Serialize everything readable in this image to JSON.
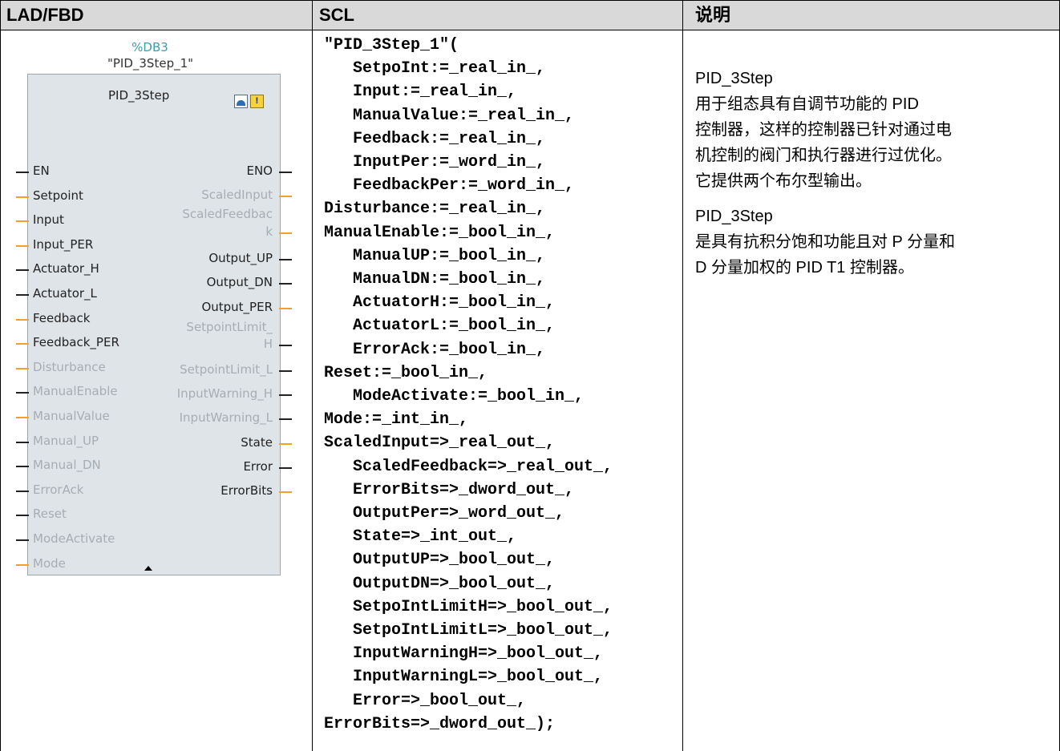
{
  "headers": {
    "col1": "LAD/FBD",
    "col2": "SCL",
    "col3": "说明"
  },
  "lad": {
    "db": "%DB3",
    "instance": "\"PID_3Step_1\"",
    "block_title": "PID_3Step",
    "inputs": [
      {
        "label": "EN",
        "state": "dark",
        "lead": "black"
      },
      {
        "label": "Setpoint",
        "state": "dark",
        "lead": "orange"
      },
      {
        "label": "Input",
        "state": "dark",
        "lead": "orange"
      },
      {
        "label": "Input_PER",
        "state": "dark",
        "lead": "orange"
      },
      {
        "label": "Actuator_H",
        "state": "dark",
        "lead": "black"
      },
      {
        "label": "Actuator_L",
        "state": "dark",
        "lead": "black"
      },
      {
        "label": "Feedback",
        "state": "dark",
        "lead": "orange"
      },
      {
        "label": "Feedback_PER",
        "state": "dark",
        "lead": "orange"
      },
      {
        "label": "Disturbance",
        "state": "gray",
        "lead": "orange"
      },
      {
        "label": "ManualEnable",
        "state": "gray",
        "lead": "black"
      },
      {
        "label": "ManualValue",
        "state": "gray",
        "lead": "orange"
      },
      {
        "label": "Manual_UP",
        "state": "gray",
        "lead": "black"
      },
      {
        "label": "Manual_DN",
        "state": "gray",
        "lead": "black"
      },
      {
        "label": "ErrorAck",
        "state": "gray",
        "lead": "black"
      },
      {
        "label": "Reset",
        "state": "gray",
        "lead": "black"
      },
      {
        "label": "ModeActivate",
        "state": "gray",
        "lead": "black"
      },
      {
        "label": "Mode",
        "state": "gray",
        "lead": "orange"
      }
    ],
    "outputs": [
      {
        "label": "ENO",
        "state": "dark",
        "lead": "black"
      },
      {
        "label": "ScaledInput",
        "state": "gray",
        "lead": "orange"
      },
      {
        "label": "ScaledFeedbac",
        "state": "gray",
        "lead": "none"
      },
      {
        "label": "k",
        "state": "gray",
        "lead": "orange"
      },
      {
        "label": "Output_UP",
        "state": "dark",
        "lead": "black"
      },
      {
        "label": "Output_DN",
        "state": "dark",
        "lead": "black"
      },
      {
        "label": "Output_PER",
        "state": "dark",
        "lead": "orange"
      },
      {
        "label": "SetpointLimit_",
        "state": "gray",
        "lead": "none"
      },
      {
        "label": "H",
        "state": "gray",
        "lead": "black"
      },
      {
        "label": "SetpointLimit_L",
        "state": "gray",
        "lead": "black"
      },
      {
        "label": "InputWarning_H",
        "state": "gray",
        "lead": "black"
      },
      {
        "label": "InputWarning_L",
        "state": "gray",
        "lead": "black"
      },
      {
        "label": "State",
        "state": "dark",
        "lead": "orange"
      },
      {
        "label": "Error",
        "state": "dark",
        "lead": "black"
      },
      {
        "label": "ErrorBits",
        "state": "dark",
        "lead": "orange"
      }
    ]
  },
  "scl": {
    "lines": [
      "\"PID_3Step_1\"(",
      "   SetpoInt:=_real_in_,",
      "   Input:=_real_in_,",
      "   ManualValue:=_real_in_,",
      "   Feedback:=_real_in_,",
      "   InputPer:=_word_in_,",
      "   FeedbackPer:=_word_in_,",
      "Disturbance:=_real_in_,",
      "ManualEnable:=_bool_in_,",
      "   ManualUP:=_bool_in_,",
      "   ManualDN:=_bool_in_,",
      "   ActuatorH:=_bool_in_,",
      "   ActuatorL:=_bool_in_,",
      "   ErrorAck:=_bool_in_,",
      "Reset:=_bool_in_,",
      "   ModeActivate:=_bool_in_,",
      "Mode:=_int_in_,",
      "ScaledInput=>_real_out_,",
      "   ScaledFeedback=>_real_out_,",
      "   ErrorBits=>_dword_out_,",
      "   OutputPer=>_word_out_,",
      "   State=>_int_out_,",
      "   OutputUP=>_bool_out_,",
      "   OutputDN=>_bool_out_,",
      "   SetpoIntLimitH=>_bool_out_,",
      "   SetpoIntLimitL=>_bool_out_,",
      "   InputWarningH=>_bool_out_,",
      "   InputWarningL=>_bool_out_,",
      "   Error=>_bool_out_,",
      "ErrorBits=>_dword_out_);"
    ]
  },
  "description": {
    "p1_title": "PID_3Step",
    "p1_l1": "用于组态具有自调节功能的 PID",
    "p1_l2": "控制器，这样的控制器已针对通过电",
    "p1_l3": "机控制的阀门和执行器进行过优化。",
    "p1_l4": "它提供两个布尔型输出。",
    "p2_title": "PID_3Step",
    "p2_l1": "是具有抗积分饱和功能且对 P 分量和",
    "p2_l2": "D 分量加权的 PID T1 控制器。"
  },
  "colors": {
    "header_bg": "#d9d9d9",
    "block_bg": "#dfe4e8",
    "db_color": "#3aa0a8",
    "lead_orange": "#f0a030"
  }
}
